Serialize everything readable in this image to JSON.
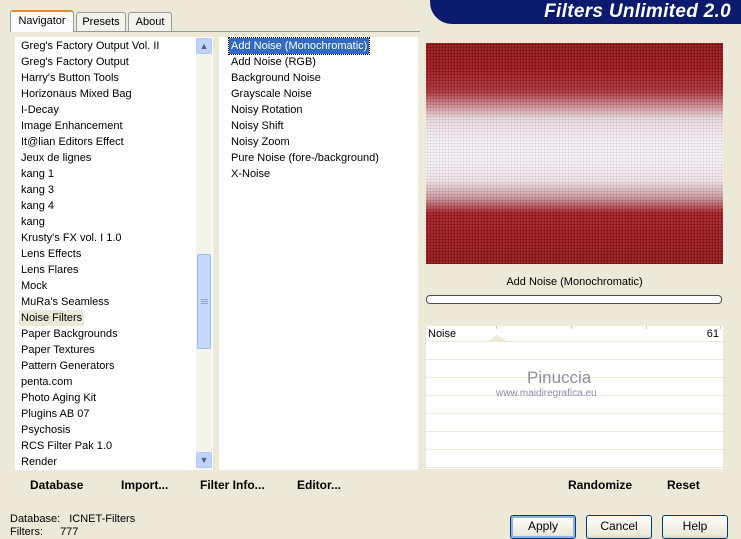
{
  "tabs": [
    "Navigator",
    "Presets",
    "About"
  ],
  "banner_title": "Filters Unlimited 2.0",
  "categories": [
    "Greg's Factory Output Vol. II",
    "Greg's Factory Output",
    "Harry's Button Tools",
    "Horizonaus Mixed Bag",
    "I-Decay",
    "Image Enhancement",
    "It@lian Editors Effect",
    "Jeux de lignes",
    "kang 1",
    "kang 3",
    "kang 4",
    "kang",
    "Krusty's FX vol. I 1.0",
    "Lens Effects",
    "Lens Flares",
    "Mock",
    "MuRa's Seamless",
    "Noise Filters",
    "Paper Backgrounds",
    "Paper Textures",
    "Pattern Generators",
    "penta.com",
    "Photo Aging Kit",
    "Plugins AB 07",
    "Psychosis",
    "RCS Filter Pak 1.0",
    "Render"
  ],
  "selected_category": "Noise Filters",
  "filters": [
    "Add Noise (Monochromatic)",
    "Add Noise (RGB)",
    "Background Noise",
    "Grayscale Noise",
    "Noisy Rotation",
    "Noisy Shift",
    "Noisy Zoom",
    "Pure Noise (fore-/background)",
    "X-Noise"
  ],
  "selected_filter": "Add Noise (Monochromatic)",
  "current_filter_name": "Add Noise (Monochromatic)",
  "parameter": {
    "label": "Noise",
    "value": "61"
  },
  "watermark": {
    "name": "Pinuccia",
    "url": "www.maidiregrafica.eu"
  },
  "bottom_links": [
    "Database",
    "Import...",
    "Filter Info...",
    "Editor..."
  ],
  "randomize_label": "Randomize",
  "reset_label": "Reset",
  "buttons": {
    "apply": "Apply",
    "cancel": "Cancel",
    "help": "Help"
  },
  "status": {
    "database_label": "Database:",
    "database_value": "ICNET-Filters",
    "filters_label": "Filters:",
    "filters_value": "777"
  },
  "colors": {
    "selection": "#316ac5",
    "banner": "#0a1b6e",
    "tab_highlight": "#e68b2c"
  }
}
